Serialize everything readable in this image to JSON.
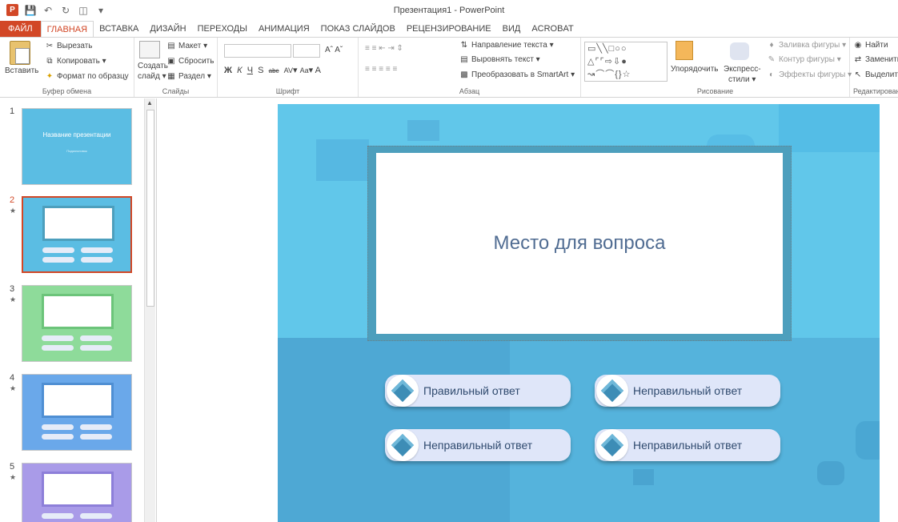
{
  "window": {
    "title": "Презентация1 - PowerPoint"
  },
  "tabs": [
    {
      "label": "ФАЙЛ"
    },
    {
      "label": "ГЛАВНАЯ"
    },
    {
      "label": "ВСТАВКА"
    },
    {
      "label": "ДИЗАЙН"
    },
    {
      "label": "ПЕРЕХОДЫ"
    },
    {
      "label": "АНИМАЦИЯ"
    },
    {
      "label": "ПОКАЗ СЛАЙДОВ"
    },
    {
      "label": "РЕЦЕНЗИРОВАНИЕ"
    },
    {
      "label": "ВИД"
    },
    {
      "label": "ACROBAT"
    }
  ],
  "ribbon": {
    "clipboard": {
      "paste": "Вставить",
      "cut": "Вырезать",
      "copy": "Копировать",
      "format_painter": "Формат по образцу",
      "label": "Буфер обмена"
    },
    "slides": {
      "create": "Создать",
      "create2": "слайд",
      "layout": "Макет",
      "reset": "Сбросить",
      "section": "Раздел",
      "label": "Слайды"
    },
    "font": {
      "label": "Шрифт",
      "bold": "Ж",
      "italic": "К",
      "underline": "Ч",
      "shadow": "S",
      "strike": "abc",
      "spacing": "AV",
      "case": "Aa",
      "color": "A"
    },
    "paragraph": {
      "direction": "Направление текста",
      "align": "Выровнять текст",
      "smartart": "Преобразовать в SmartArt",
      "label": "Абзац"
    },
    "drawing": {
      "arrange": "Упорядочить",
      "quick_styles": "Экспресс-",
      "quick_styles2": "стили",
      "fill": "Заливка фигуры",
      "outline": "Контур фигуры",
      "effects": "Эффекты фигуры",
      "label": "Рисование"
    },
    "editing": {
      "find": "Найти",
      "replace": "Заменить",
      "select": "Выделить",
      "label": "Редактирован"
    }
  },
  "thumbnails": [
    {
      "num": "1",
      "title": "Название презентации",
      "subtitle": "Подзаголовок"
    },
    {
      "num": "2",
      "star": "★",
      "answers": [
        "Правильный ответ",
        "Неправильный ответ",
        "Неправильный ответ",
        "Неправильный ответ"
      ]
    },
    {
      "num": "3",
      "star": "★"
    },
    {
      "num": "4",
      "star": "★"
    },
    {
      "num": "5",
      "star": "★"
    }
  ],
  "slide": {
    "question": "Место для вопроса",
    "answers": [
      "Правильный ответ",
      "Неправильный ответ",
      "Неправильный ответ",
      "Неправильный ответ"
    ]
  },
  "colors": {
    "accent": "#d24726",
    "slide_bg": "#61c7ea",
    "question_text": "#506c92",
    "answer_bg": "#dfe6f9"
  }
}
